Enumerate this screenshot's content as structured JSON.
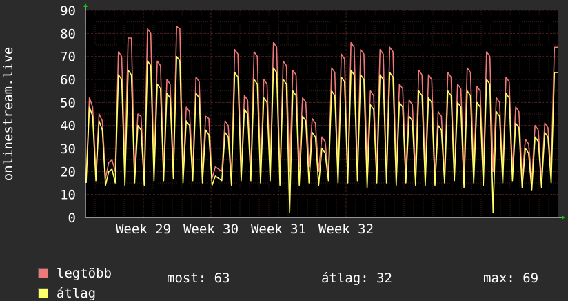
{
  "chart_data": {
    "type": "line",
    "ylabel": "onlinestream.live",
    "ylim": [
      0,
      90
    ],
    "yticks": [
      0,
      10,
      20,
      30,
      40,
      50,
      60,
      70,
      80,
      90
    ],
    "xticks": [
      "Week 29",
      "Week 30",
      "Week 31",
      "Week 32"
    ],
    "grid": true,
    "series": [
      {
        "name": "legtöbb",
        "color": "#f07878",
        "daily_peaks": [
          52,
          45,
          25,
          72,
          78,
          45,
          82,
          68,
          60,
          83,
          48,
          61,
          44,
          22,
          42,
          73,
          53,
          72,
          60,
          76,
          68,
          64,
          52,
          43,
          35,
          65,
          71,
          76,
          73,
          55,
          73,
          74,
          58,
          51,
          64,
          62,
          46,
          63,
          58,
          65,
          57,
          72,
          52,
          61,
          48,
          34,
          40,
          41,
          74
        ],
        "values": [
          18,
          52,
          48,
          20,
          45,
          42,
          17,
          24,
          25,
          20,
          72,
          70,
          22,
          78,
          78,
          20,
          45,
          44,
          18,
          82,
          80,
          20,
          68,
          66,
          20,
          60,
          58,
          22,
          83,
          82,
          18,
          48,
          46,
          20,
          61,
          59,
          18,
          44,
          43,
          17,
          22,
          21,
          20,
          42,
          40,
          17,
          73,
          71,
          19,
          53,
          51,
          20,
          72,
          70,
          18,
          60,
          58,
          19,
          76,
          74,
          18,
          68,
          66,
          20,
          64,
          62,
          22,
          52,
          50,
          22,
          43,
          41,
          20,
          35,
          33,
          18,
          65,
          63,
          17,
          71,
          69,
          18,
          76,
          74,
          20,
          73,
          71,
          22,
          55,
          53,
          20,
          73,
          71,
          17,
          74,
          72,
          18,
          58,
          56,
          20,
          51,
          49,
          20,
          64,
          62,
          18,
          62,
          60,
          17,
          46,
          44,
          18,
          63,
          61,
          18,
          58,
          56,
          20,
          65,
          63,
          20,
          57,
          55,
          19,
          72,
          70,
          20,
          52,
          50,
          18,
          61,
          59,
          20,
          48,
          46,
          17,
          34,
          32,
          16,
          40,
          38,
          16,
          41,
          39,
          20,
          74,
          74
        ]
      },
      {
        "name": "átlag",
        "color": "#ffff66",
        "daily_peaks": [
          48,
          42,
          20,
          62,
          64,
          40,
          68,
          58,
          54,
          70,
          42,
          54,
          38,
          18,
          37,
          63,
          47,
          60,
          52,
          65,
          60,
          55,
          44,
          37,
          30,
          55,
          61,
          64,
          62,
          49,
          62,
          63,
          50,
          44,
          55,
          52,
          40,
          55,
          50,
          55,
          50,
          60,
          46,
          54,
          41,
          30,
          35,
          37,
          63
        ],
        "values": [
          15,
          48,
          44,
          16,
          42,
          38,
          14,
          20,
          21,
          15,
          62,
          60,
          14,
          64,
          62,
          15,
          40,
          38,
          14,
          68,
          66,
          16,
          58,
          56,
          16,
          54,
          52,
          17,
          70,
          68,
          15,
          42,
          40,
          16,
          54,
          52,
          15,
          38,
          36,
          14,
          18,
          17,
          16,
          37,
          35,
          14,
          63,
          61,
          16,
          47,
          45,
          16,
          60,
          58,
          15,
          52,
          50,
          16,
          65,
          63,
          14,
          60,
          58,
          2,
          55,
          53,
          14,
          44,
          42,
          15,
          37,
          35,
          14,
          30,
          28,
          16,
          55,
          53,
          15,
          61,
          59,
          15,
          64,
          62,
          16,
          62,
          60,
          13,
          49,
          47,
          15,
          62,
          60,
          15,
          63,
          61,
          14,
          50,
          48,
          15,
          44,
          42,
          14,
          55,
          53,
          14,
          52,
          50,
          14,
          40,
          38,
          15,
          55,
          53,
          16,
          50,
          48,
          13,
          55,
          53,
          15,
          50,
          48,
          14,
          60,
          58,
          2,
          46,
          44,
          15,
          54,
          52,
          16,
          41,
          39,
          13,
          30,
          28,
          12,
          35,
          33,
          13,
          37,
          35,
          15,
          63,
          63
        ]
      }
    ]
  },
  "legend": {
    "items": [
      {
        "label": "legtöbb",
        "color": "#f07878"
      },
      {
        "label": "átlag",
        "color": "#ffff66"
      }
    ],
    "stats": {
      "most": "most: 63",
      "atlag": "átlag: 32",
      "max": "max: 69"
    }
  },
  "colors": {
    "background": "#2b2b2b",
    "plot_bg": "#000000",
    "grid_major": "#4a2020",
    "grid_minor": "#3a1818",
    "axis": "#ffffff"
  }
}
